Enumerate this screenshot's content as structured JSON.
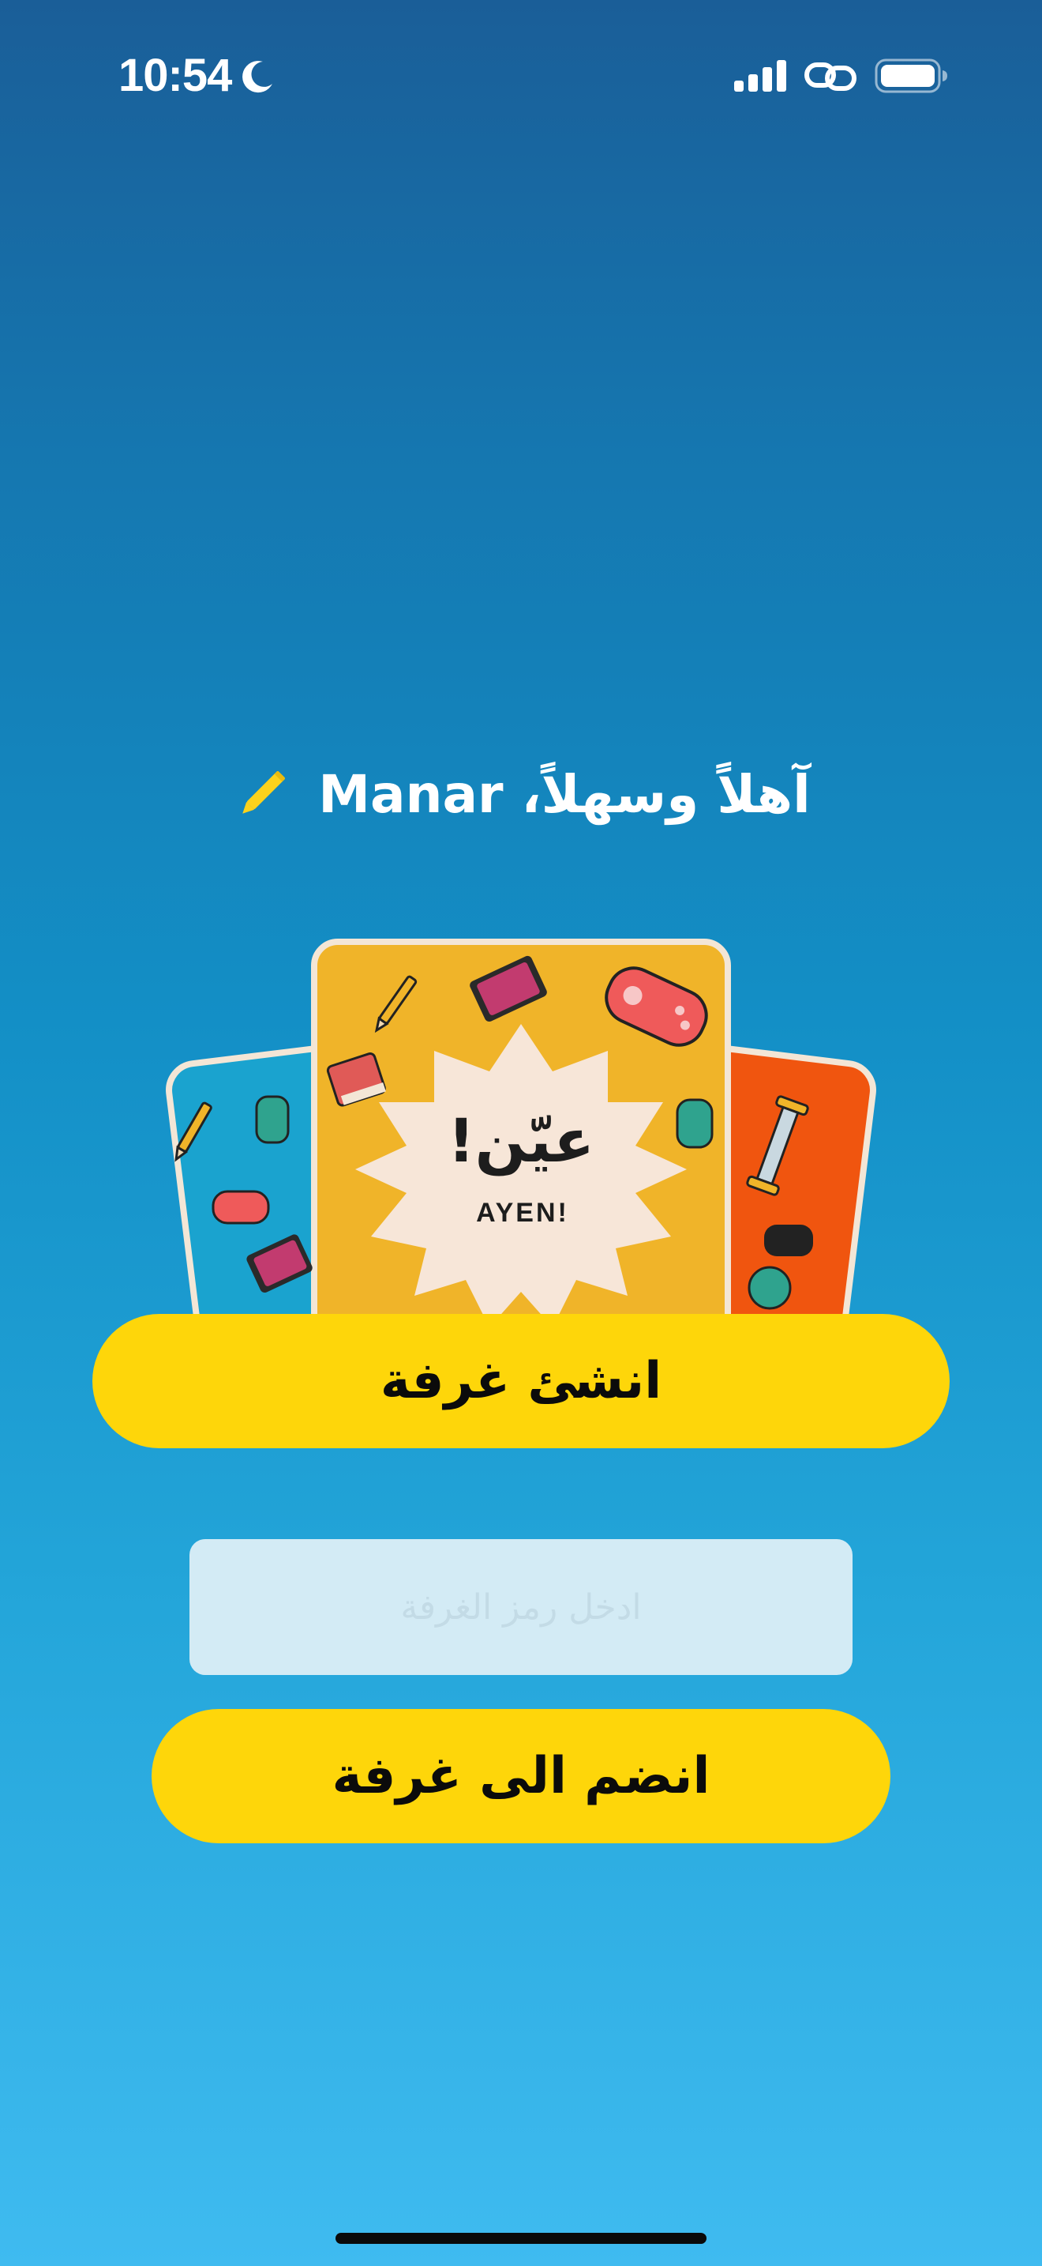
{
  "status_bar": {
    "time": "10:54",
    "icons": [
      "moon-icon",
      "cellular-signal-icon",
      "personal-hotspot-link-icon",
      "battery-icon"
    ]
  },
  "greeting": {
    "text": "آهلاً وسهلاً، Manar",
    "edit_icon": "pencil-icon"
  },
  "card_art": {
    "title_arabic": "عيّن!",
    "title_latin": "AYEN!"
  },
  "actions": {
    "create_room_label": "انشئ غرفة",
    "room_code_placeholder": "ادخل رمز الغرفة",
    "room_code_value": "",
    "join_room_label": "انضم الى غرفة"
  },
  "colors": {
    "button_yellow": "#fed60a",
    "card_yellow": "#f0b429",
    "card_blue": "#1aa3cf",
    "card_orange": "#f0550f",
    "card_center": "#f7e6d8"
  }
}
